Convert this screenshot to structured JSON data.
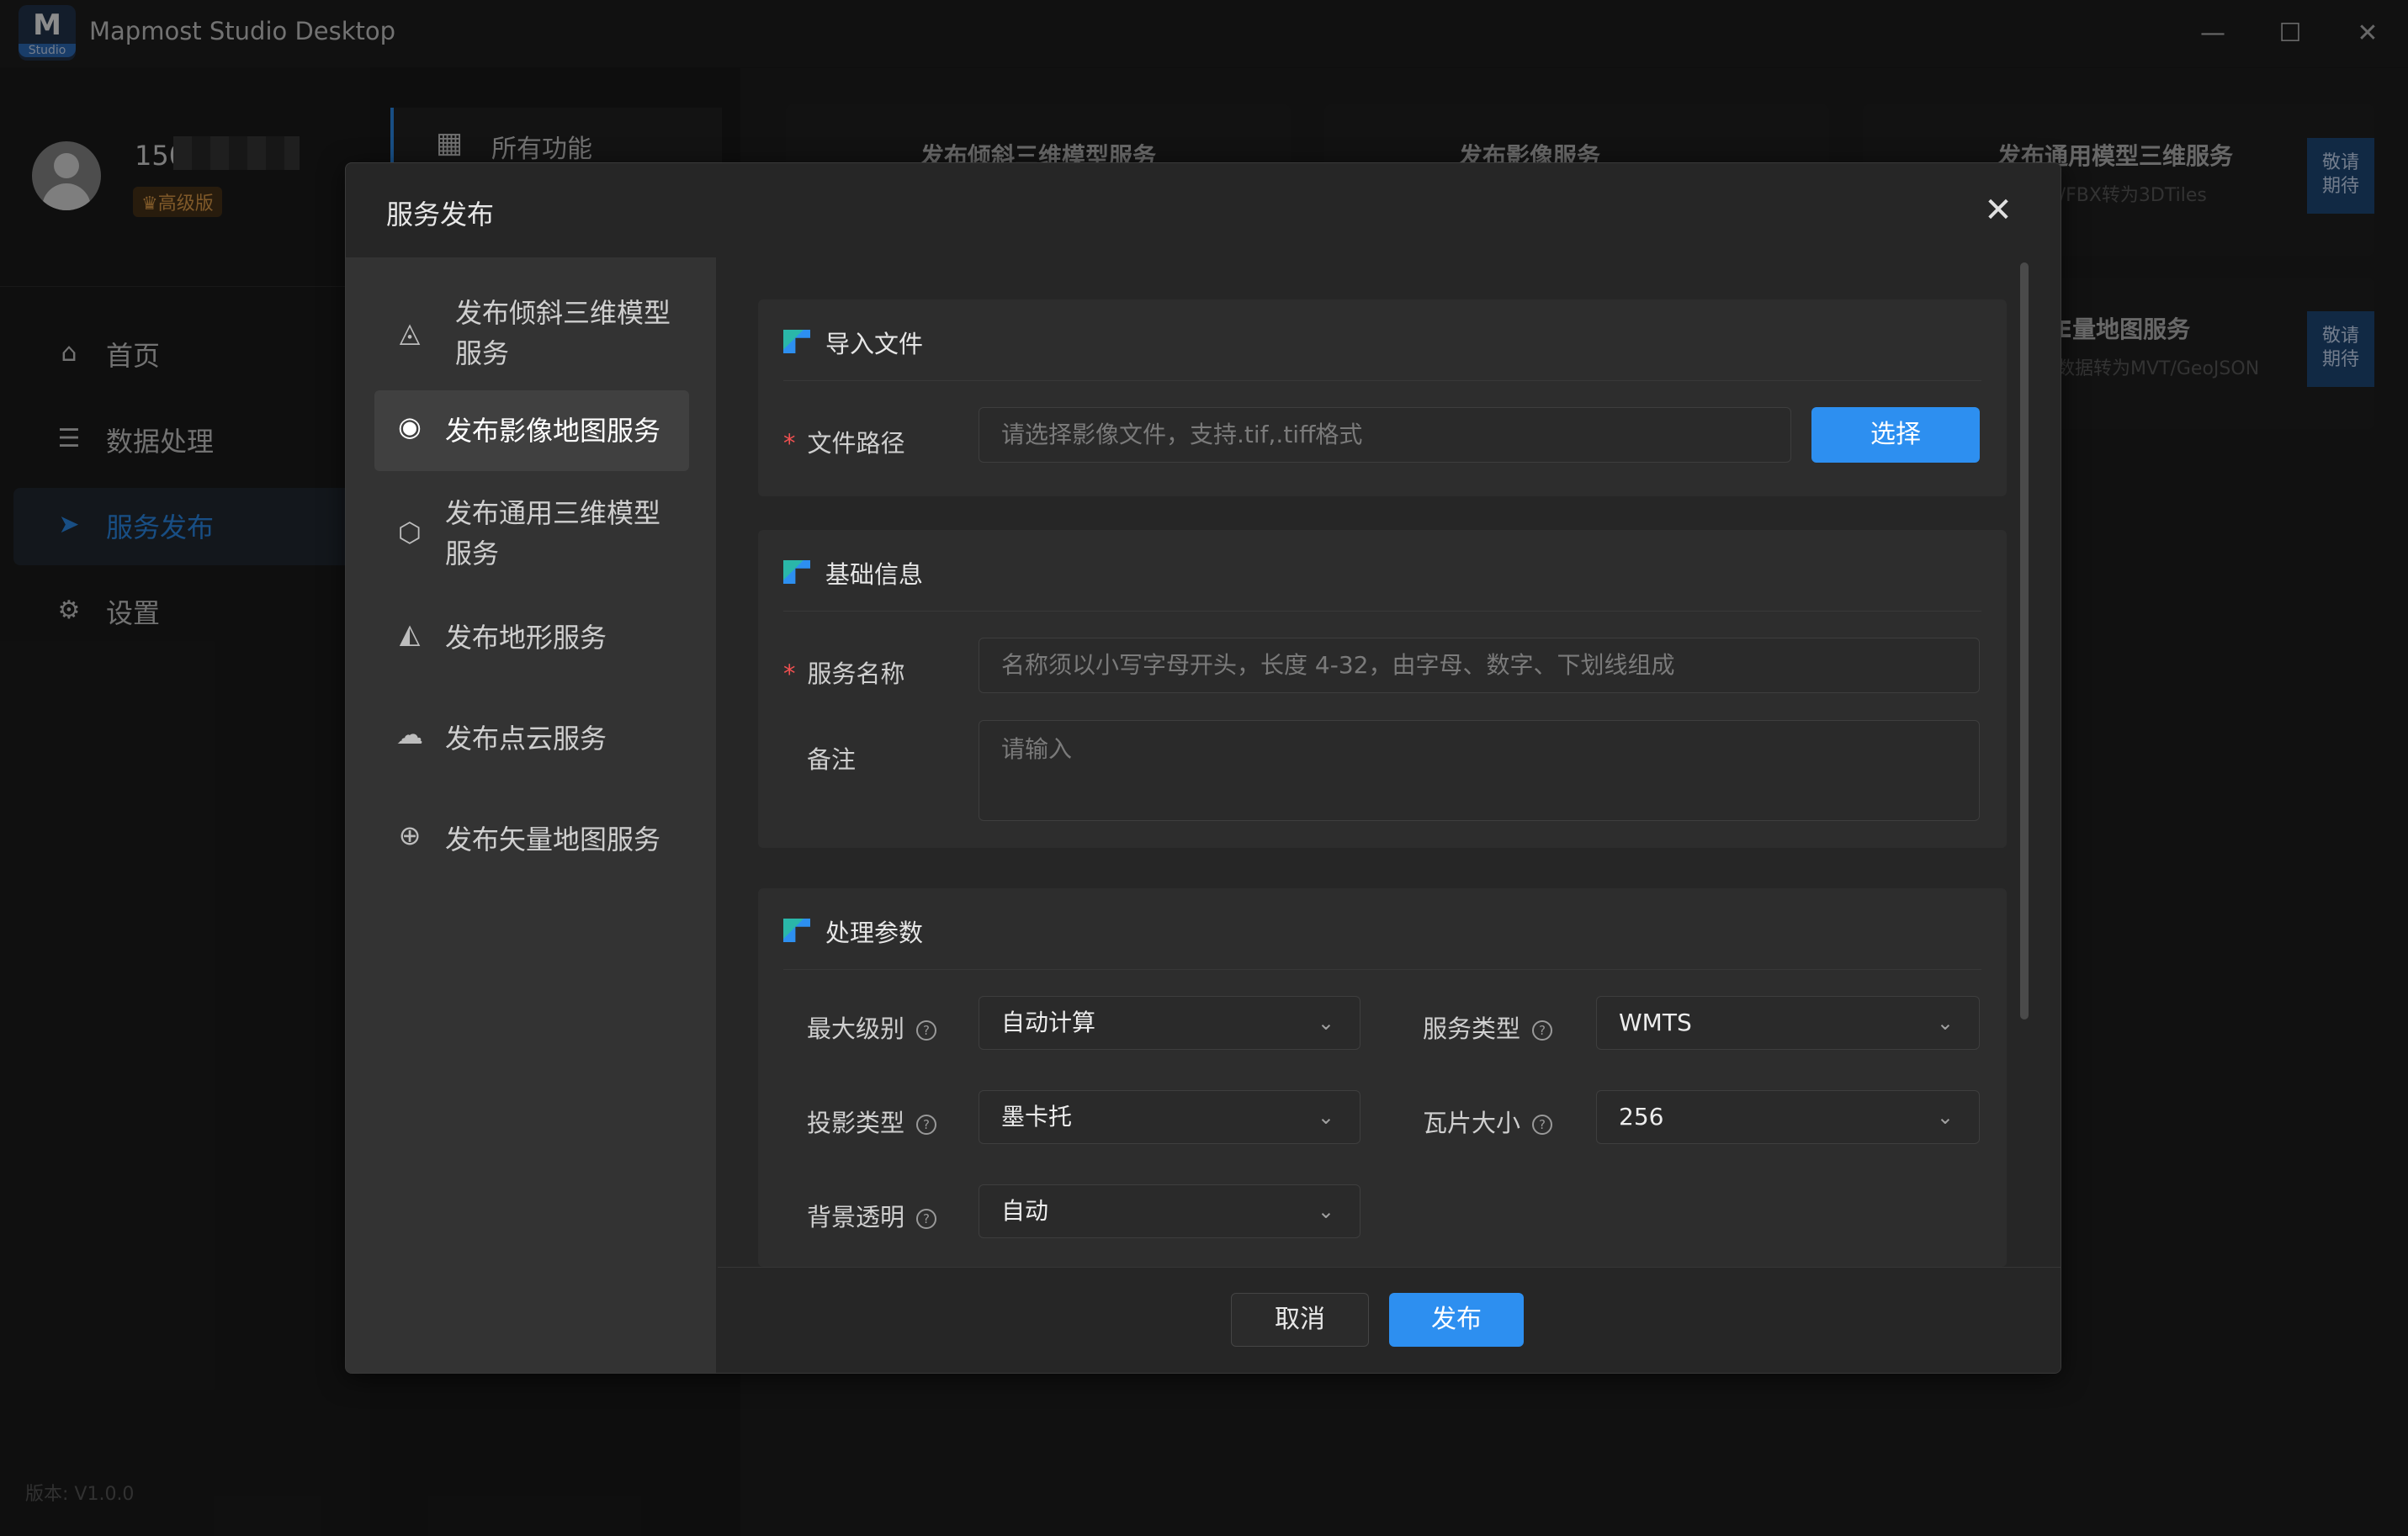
{
  "window": {
    "logo_glyph": "M",
    "logo_sub": "Studio",
    "title": "Mapmost Studio Desktop",
    "minimize_glyph": "—",
    "maximize_glyph": "☐",
    "close_glyph": "✕"
  },
  "user": {
    "name_prefix": "150",
    "badge": "♛高级版"
  },
  "nav": {
    "items": [
      {
        "label": "首页",
        "icon": "home-icon",
        "glyph": "⌂"
      },
      {
        "label": "数据处理",
        "icon": "database-icon",
        "glyph": "☰"
      },
      {
        "label": "服务发布",
        "icon": "send-icon",
        "glyph": "➤"
      },
      {
        "label": "设置",
        "icon": "gear-icon",
        "glyph": "⚙"
      }
    ],
    "active_index": 2
  },
  "version": "版本: V1.0.0",
  "background": {
    "all_functions": "所有功能",
    "all_functions_glyph": "▦",
    "cards": [
      {
        "title": "发布倾斜三维模型服务",
        "desc": "",
        "ribbon": ""
      },
      {
        "title": "发布影像服务",
        "desc": "",
        "ribbon": ""
      },
      {
        "title": "发布通用模型三维服务",
        "desc": "LB/OBJ/FBX转为3DTiles",
        "ribbon": "敬请\n期待"
      },
      {
        "title": "E量地图服务",
        "desc": "数据转为MVT/GeoJSON",
        "ribbon": "敬请\n期待"
      }
    ]
  },
  "modal": {
    "title": "服务发布",
    "close_glyph": "✕",
    "menu": [
      {
        "label": "发布倾斜三维模型服务",
        "icon": "pyramid-icon",
        "glyph": "◬"
      },
      {
        "label": "发布影像地图服务",
        "icon": "globe-icon",
        "glyph": "◉"
      },
      {
        "label": "发布通用三维模型服务",
        "icon": "cube-icon",
        "glyph": "⬡"
      },
      {
        "label": "发布地形服务",
        "icon": "terrain-icon",
        "glyph": "◭"
      },
      {
        "label": "发布点云服务",
        "icon": "cloud-icon",
        "glyph": "☁"
      },
      {
        "label": "发布矢量地图服务",
        "icon": "grid-globe-icon",
        "glyph": "⊕"
      }
    ],
    "active_menu": 1,
    "import": {
      "heading": "导入文件",
      "file_path_label": "文件路径",
      "file_path_placeholder": "请选择影像文件，支持.tif,.tiff格式",
      "file_path_value": "",
      "select_button": "选择"
    },
    "basic": {
      "heading": "基础信息",
      "service_name_label": "服务名称",
      "service_name_placeholder": "名称须以小写字母开头，长度 4-32，由字母、数字、下划线组成",
      "service_name_value": "",
      "remark_label": "备注",
      "remark_placeholder": "请输入",
      "remark_value": ""
    },
    "params": {
      "heading": "处理参数",
      "help_glyph": "?",
      "chevron_glyph": "⌄",
      "max_level_label": "最大级别",
      "max_level_value": "自动计算",
      "service_type_label": "服务类型",
      "service_type_value": "WMTS",
      "projection_label": "投影类型",
      "projection_value": "墨卡托",
      "tile_size_label": "瓦片大小",
      "tile_size_value": "256",
      "bg_transparent_label": "背景透明",
      "bg_transparent_value": "自动"
    },
    "footer": {
      "cancel": "取消",
      "publish": "发布"
    }
  },
  "colors": {
    "accent": "#2d8ff0",
    "required": "#f05050",
    "badge_text": "#e7a24c"
  }
}
